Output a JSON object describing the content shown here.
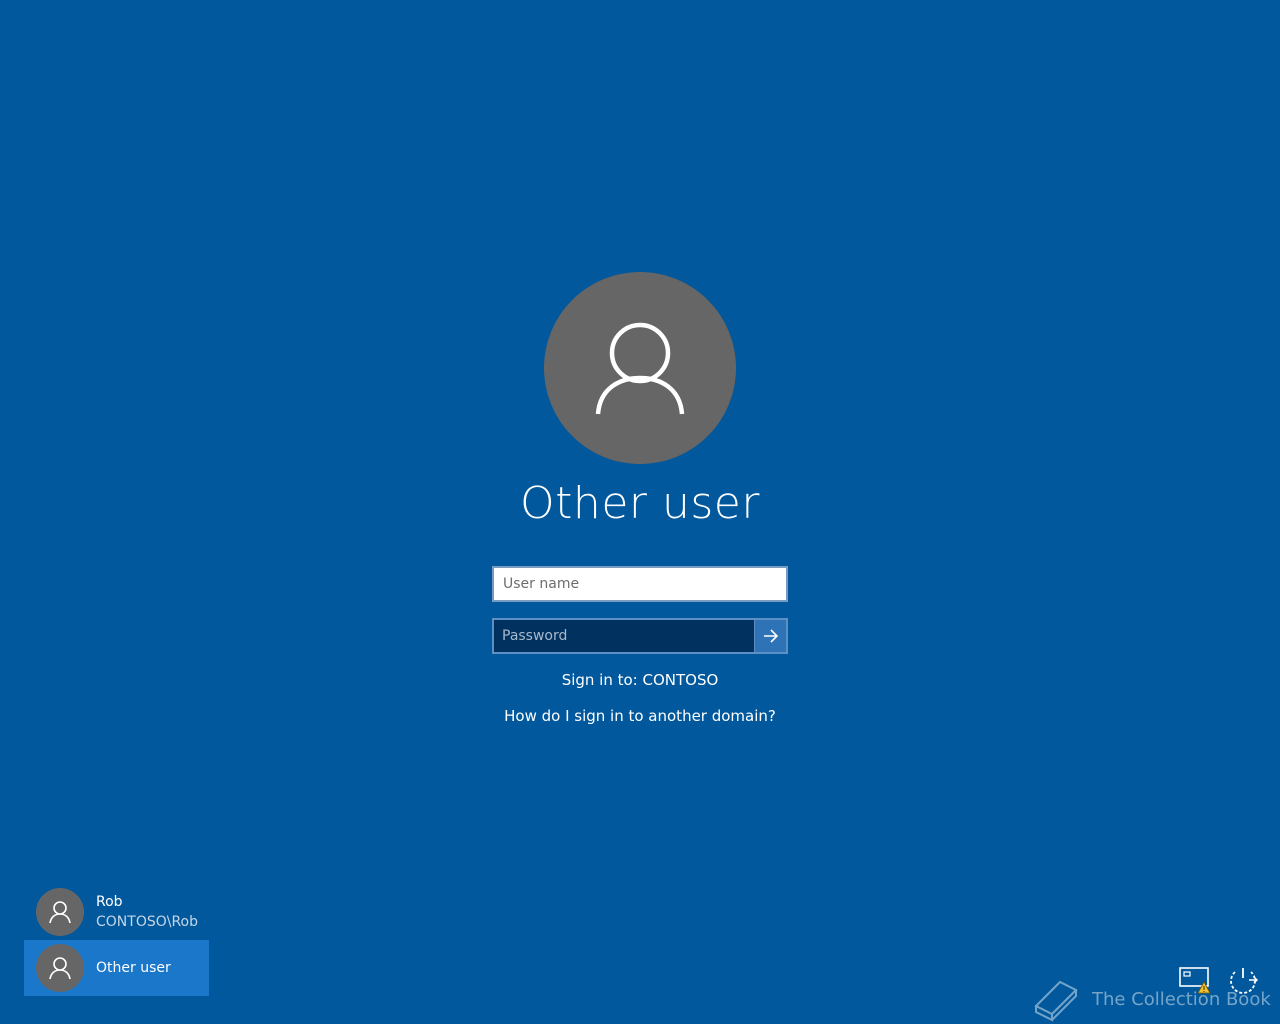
{
  "login": {
    "user_title": "Other user",
    "username_placeholder": "User name",
    "password_placeholder": "Password",
    "sign_in_to": "Sign in to: CONTOSO",
    "domain_help_link": "How do I sign in to another domain?"
  },
  "user_list": [
    {
      "name": "Rob",
      "account": "CONTOSO\\Rob",
      "selected": false
    },
    {
      "name": "Other user",
      "account": "",
      "selected": true
    }
  ],
  "corner": {
    "network_icon": "network-warning-icon",
    "ease_of_access_icon": "ease-of-access-icon",
    "power_icon": "power-icon"
  },
  "watermark": {
    "text": "The Collection Book"
  },
  "colors": {
    "background": "#01589c",
    "avatar": "#666666",
    "selected_tile": "#1a77c9",
    "password_field": "#00315f",
    "submit_button": "#2d73b5"
  }
}
